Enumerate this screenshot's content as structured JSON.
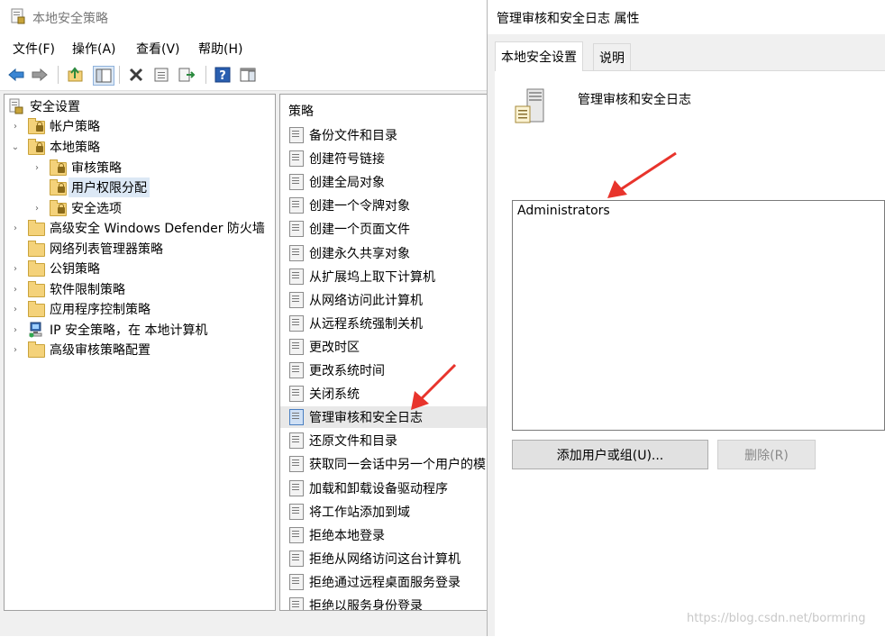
{
  "main_window": {
    "title": "本地安全策略",
    "menu": [
      "文件(F)",
      "操作(A)",
      "查看(V)",
      "帮助(H)"
    ]
  },
  "tree": [
    {
      "label": "安全设置",
      "chevron": "",
      "icon": "security-settings-icon"
    },
    {
      "label": "帐户策略",
      "chevron": "›",
      "icon": "locked-folder-icon"
    },
    {
      "label": "本地策略",
      "chevron": "⌄",
      "icon": "locked-folder-icon"
    },
    {
      "label": "审核策略",
      "chevron": "›",
      "icon": "locked-folder-icon"
    },
    {
      "label": "用户权限分配",
      "chevron": "",
      "icon": "locked-folder-icon"
    },
    {
      "label": "安全选项",
      "chevron": "›",
      "icon": "locked-folder-icon"
    },
    {
      "label": "高级安全 Windows Defender 防火墙",
      "chevron": "›",
      "icon": "folder-icon"
    },
    {
      "label": "网络列表管理器策略",
      "chevron": "",
      "icon": "folder-icon"
    },
    {
      "label": "公钥策略",
      "chevron": "›",
      "icon": "folder-icon"
    },
    {
      "label": "软件限制策略",
      "chevron": "›",
      "icon": "folder-icon"
    },
    {
      "label": "应用程序控制策略",
      "chevron": "›",
      "icon": "folder-icon"
    },
    {
      "label": "IP 安全策略，在 本地计算机",
      "chevron": "›",
      "icon": "ip-security-icon"
    },
    {
      "label": "高级审核策略配置",
      "chevron": "›",
      "icon": "folder-icon"
    }
  ],
  "list": {
    "header": "策略",
    "items": [
      "备份文件和目录",
      "创建符号链接",
      "创建全局对象",
      "创建一个令牌对象",
      "创建一个页面文件",
      "创建永久共享对象",
      "从扩展坞上取下计算机",
      "从网络访问此计算机",
      "从远程系统强制关机",
      "更改时区",
      "更改系统时间",
      "关闭系统",
      "管理审核和安全日志",
      "还原文件和目录",
      "获取同一会话中另一个用户的模",
      "加载和卸载设备驱动程序",
      "将工作站添加到域",
      "拒绝本地登录",
      "拒绝从网络访问这台计算机",
      "拒绝通过远程桌面服务登录",
      "拒绝以服务身份登录"
    ]
  },
  "dialog": {
    "title": "管理审核和安全日志 属性",
    "tabs": [
      "本地安全设置",
      "说明"
    ],
    "policy_name": "管理审核和安全日志",
    "users": [
      "Administrators"
    ],
    "add_button": "添加用户或组(U)...",
    "remove_button": "删除(R)"
  },
  "watermark": "https://blog.csdn.net/bormring",
  "colors": {
    "annotation_arrow": "#e8342c",
    "selection": "#dce8f5"
  }
}
